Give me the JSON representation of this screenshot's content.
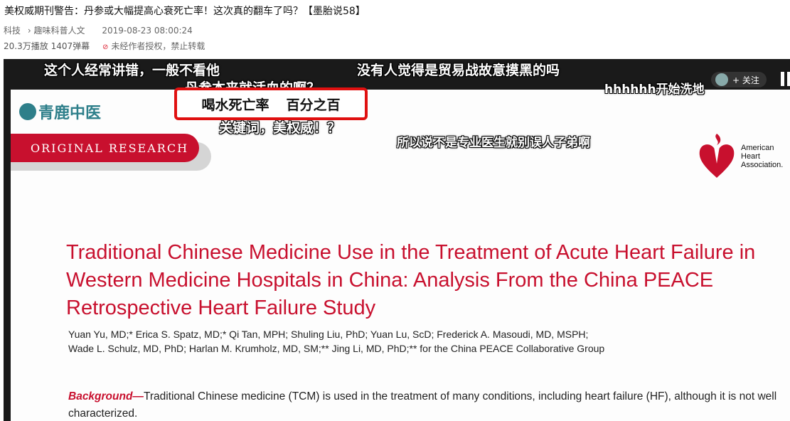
{
  "video": {
    "title": "美权威期刊警告：丹参或大幅提高心衰死亡率！这次真的翻车了吗？【墨胎说58】",
    "category": "科技",
    "subcategory": "趣味科普人文",
    "date": "2019-08-23 08:00:24",
    "plays": "20.3万播放",
    "danmaku_count": "1407弹幕",
    "copyright_notice": "未经作者授权，禁止转载",
    "follow_label": "+ 关注"
  },
  "danmaku": {
    "d1": "这个人经常讲错，一般不看他",
    "d2": "没有人觉得是贸易战故意摸黑的吗",
    "d3": "丹参本来就活血的啊？",
    "d4": "hhhhhh开始洗地",
    "d5": "关键词，美权威！？",
    "d6": "所以说不是专业医生就别误人子弟啊"
  },
  "highlight": {
    "left": "喝水死亡率",
    "right": "百分之百"
  },
  "paper": {
    "watermark": "青鹿中医",
    "banner": "ORIGINAL RESEARCH",
    "aha_line1": "American",
    "aha_line2": "Heart",
    "aha_line3": "Association.",
    "title": "Traditional Chinese Medicine Use in the Treatment of Acute Heart Failure in Western Medicine Hospitals in China: Analysis From the China PEACE Retrospective Heart Failure Study",
    "authors_line1": "Yuan Yu, MD;* Erica S. Spatz, MD;* Qi Tan, MPH; Shuling Liu, PhD; Yuan Lu, ScD; Frederick A. Masoudi, MD, MSPH;",
    "authors_line2": "Wade L. Schulz, MD, PhD; Harlan M. Krumholz, MD, SM;** Jing Li, MD, PhD;** for the China PEACE Collaborative Group",
    "abstract_lead": "Background—",
    "abstract_text": "Traditional Chinese medicine (TCM) is used in the treatment of many conditions, including heart failure (HF), although it is not well characterized."
  },
  "colors": {
    "aha_red": "#c8102e",
    "highlight_border": "#e01010",
    "logo_teal": "#2e7f8a"
  }
}
